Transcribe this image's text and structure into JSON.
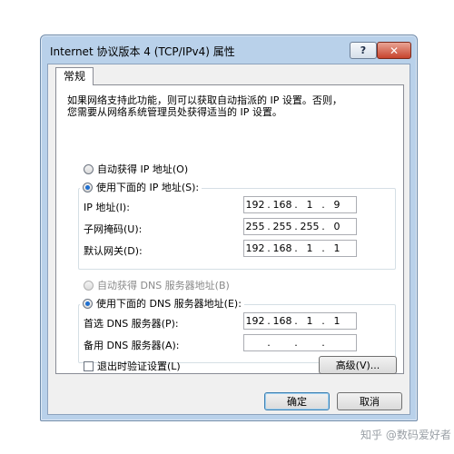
{
  "window": {
    "title": "Internet 协议版本 4 (TCP/IPv4) 属性",
    "help_label": "?",
    "close_label": "✕"
  },
  "tabs": [
    {
      "label": "常规"
    }
  ],
  "description": {
    "line1": "如果网络支持此功能，则可以获取自动指派的 IP 设置。否则，",
    "line2": "您需要从网络系统管理员处获得适当的 IP 设置。"
  },
  "ip_settings": {
    "auto_label": "自动获得 IP 地址(O)",
    "auto_selected": false,
    "manual_label": "使用下面的 IP 地址(S):",
    "manual_selected": true,
    "fields": [
      {
        "label": "IP 地址(I):",
        "octets": [
          "192",
          "168",
          "1",
          "9"
        ]
      },
      {
        "label": "子网掩码(U):",
        "octets": [
          "255",
          "255",
          "255",
          "0"
        ]
      },
      {
        "label": "默认网关(D):",
        "octets": [
          "192",
          "168",
          "1",
          "1"
        ]
      }
    ]
  },
  "dns_settings": {
    "auto_label": "自动获得 DNS 服务器地址(B)",
    "auto_enabled": false,
    "manual_label": "使用下面的 DNS 服务器地址(E):",
    "manual_selected": true,
    "fields": [
      {
        "label": "首选 DNS 服务器(P):",
        "octets": [
          "192",
          "168",
          "1",
          "1"
        ]
      },
      {
        "label": "备用 DNS 服务器(A):",
        "octets": [
          "",
          "",
          "",
          ""
        ]
      }
    ]
  },
  "validate_on_exit": {
    "label": "退出时验证设置(L)",
    "checked": false
  },
  "buttons": {
    "advanced": "高级(V)...",
    "ok": "确定",
    "cancel": "取消"
  },
  "watermark": "知乎 @数码爱好者",
  "colors": {
    "frame": "#b9d1ea",
    "accent": "#1e6fd0",
    "close": "#c7432d"
  }
}
